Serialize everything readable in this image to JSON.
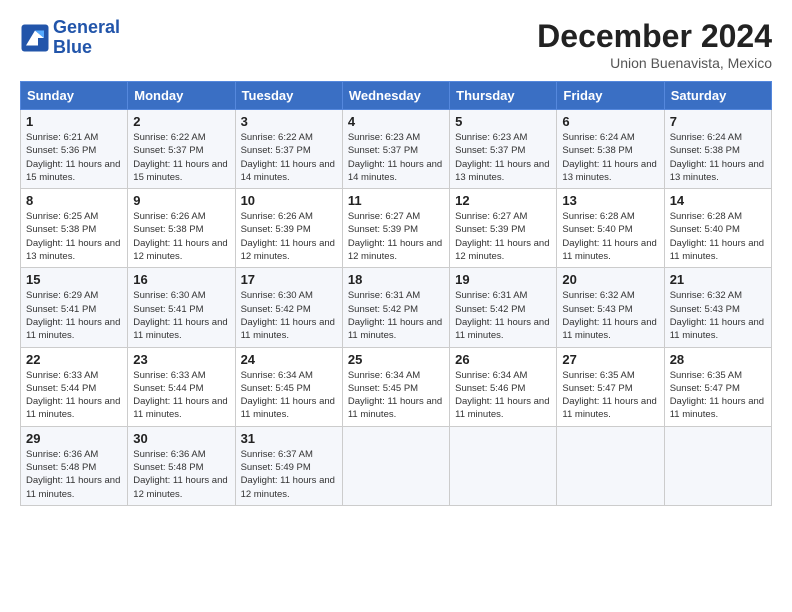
{
  "logo": {
    "line1": "General",
    "line2": "Blue"
  },
  "title": "December 2024",
  "subtitle": "Union Buenavista, Mexico",
  "days_of_week": [
    "Sunday",
    "Monday",
    "Tuesday",
    "Wednesday",
    "Thursday",
    "Friday",
    "Saturday"
  ],
  "weeks": [
    [
      {
        "day": "1",
        "sunrise": "6:21 AM",
        "sunset": "5:36 PM",
        "daylight": "11 hours and 15 minutes."
      },
      {
        "day": "2",
        "sunrise": "6:22 AM",
        "sunset": "5:37 PM",
        "daylight": "11 hours and 15 minutes."
      },
      {
        "day": "3",
        "sunrise": "6:22 AM",
        "sunset": "5:37 PM",
        "daylight": "11 hours and 14 minutes."
      },
      {
        "day": "4",
        "sunrise": "6:23 AM",
        "sunset": "5:37 PM",
        "daylight": "11 hours and 14 minutes."
      },
      {
        "day": "5",
        "sunrise": "6:23 AM",
        "sunset": "5:37 PM",
        "daylight": "11 hours and 13 minutes."
      },
      {
        "day": "6",
        "sunrise": "6:24 AM",
        "sunset": "5:38 PM",
        "daylight": "11 hours and 13 minutes."
      },
      {
        "day": "7",
        "sunrise": "6:24 AM",
        "sunset": "5:38 PM",
        "daylight": "11 hours and 13 minutes."
      }
    ],
    [
      {
        "day": "8",
        "sunrise": "6:25 AM",
        "sunset": "5:38 PM",
        "daylight": "11 hours and 13 minutes."
      },
      {
        "day": "9",
        "sunrise": "6:26 AM",
        "sunset": "5:38 PM",
        "daylight": "11 hours and 12 minutes."
      },
      {
        "day": "10",
        "sunrise": "6:26 AM",
        "sunset": "5:39 PM",
        "daylight": "11 hours and 12 minutes."
      },
      {
        "day": "11",
        "sunrise": "6:27 AM",
        "sunset": "5:39 PM",
        "daylight": "11 hours and 12 minutes."
      },
      {
        "day": "12",
        "sunrise": "6:27 AM",
        "sunset": "5:39 PM",
        "daylight": "11 hours and 12 minutes."
      },
      {
        "day": "13",
        "sunrise": "6:28 AM",
        "sunset": "5:40 PM",
        "daylight": "11 hours and 11 minutes."
      },
      {
        "day": "14",
        "sunrise": "6:28 AM",
        "sunset": "5:40 PM",
        "daylight": "11 hours and 11 minutes."
      }
    ],
    [
      {
        "day": "15",
        "sunrise": "6:29 AM",
        "sunset": "5:41 PM",
        "daylight": "11 hours and 11 minutes."
      },
      {
        "day": "16",
        "sunrise": "6:30 AM",
        "sunset": "5:41 PM",
        "daylight": "11 hours and 11 minutes."
      },
      {
        "day": "17",
        "sunrise": "6:30 AM",
        "sunset": "5:42 PM",
        "daylight": "11 hours and 11 minutes."
      },
      {
        "day": "18",
        "sunrise": "6:31 AM",
        "sunset": "5:42 PM",
        "daylight": "11 hours and 11 minutes."
      },
      {
        "day": "19",
        "sunrise": "6:31 AM",
        "sunset": "5:42 PM",
        "daylight": "11 hours and 11 minutes."
      },
      {
        "day": "20",
        "sunrise": "6:32 AM",
        "sunset": "5:43 PM",
        "daylight": "11 hours and 11 minutes."
      },
      {
        "day": "21",
        "sunrise": "6:32 AM",
        "sunset": "5:43 PM",
        "daylight": "11 hours and 11 minutes."
      }
    ],
    [
      {
        "day": "22",
        "sunrise": "6:33 AM",
        "sunset": "5:44 PM",
        "daylight": "11 hours and 11 minutes."
      },
      {
        "day": "23",
        "sunrise": "6:33 AM",
        "sunset": "5:44 PM",
        "daylight": "11 hours and 11 minutes."
      },
      {
        "day": "24",
        "sunrise": "6:34 AM",
        "sunset": "5:45 PM",
        "daylight": "11 hours and 11 minutes."
      },
      {
        "day": "25",
        "sunrise": "6:34 AM",
        "sunset": "5:45 PM",
        "daylight": "11 hours and 11 minutes."
      },
      {
        "day": "26",
        "sunrise": "6:34 AM",
        "sunset": "5:46 PM",
        "daylight": "11 hours and 11 minutes."
      },
      {
        "day": "27",
        "sunrise": "6:35 AM",
        "sunset": "5:47 PM",
        "daylight": "11 hours and 11 minutes."
      },
      {
        "day": "28",
        "sunrise": "6:35 AM",
        "sunset": "5:47 PM",
        "daylight": "11 hours and 11 minutes."
      }
    ],
    [
      {
        "day": "29",
        "sunrise": "6:36 AM",
        "sunset": "5:48 PM",
        "daylight": "11 hours and 11 minutes."
      },
      {
        "day": "30",
        "sunrise": "6:36 AM",
        "sunset": "5:48 PM",
        "daylight": "11 hours and 12 minutes."
      },
      {
        "day": "31",
        "sunrise": "6:37 AM",
        "sunset": "5:49 PM",
        "daylight": "11 hours and 12 minutes."
      },
      null,
      null,
      null,
      null
    ]
  ]
}
